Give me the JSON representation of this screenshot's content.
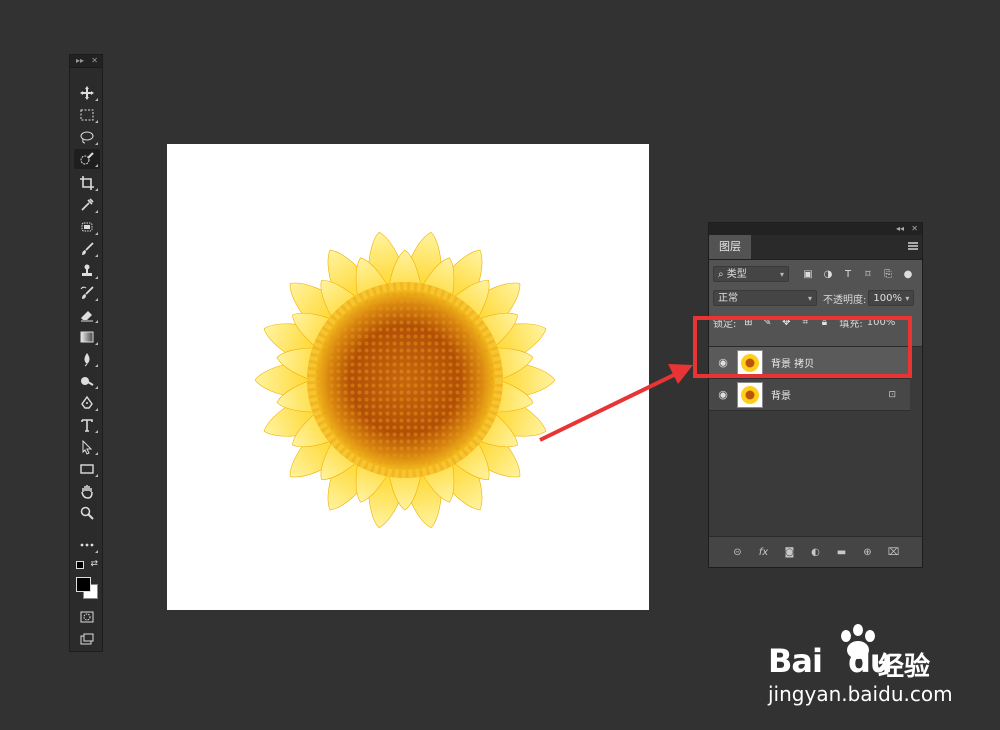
{
  "toolbar": {
    "tools": [
      "move-icon",
      "marquee-icon",
      "lasso-icon",
      "quick-select-icon",
      "crop-icon",
      "eyedropper-icon",
      "healing-icon",
      "brush-icon",
      "stamp-icon",
      "history-brush-icon",
      "eraser-icon",
      "gradient-icon",
      "blur-icon",
      "dodge-icon",
      "pen-icon",
      "text-icon",
      "path-select-icon",
      "rectangle-icon",
      "hand-icon",
      "zoom-icon",
      "more-icon"
    ]
  },
  "layers_panel": {
    "tab_label": "图层",
    "filter": {
      "label": "类型"
    },
    "blend_mode": "正常",
    "opacity_label": "不透明度:",
    "opacity_value": "100%",
    "lock_label": "锁定:",
    "fill_label": "填充:",
    "fill_value": "100%",
    "layers": [
      {
        "name": "背景 拷贝",
        "selected": true
      },
      {
        "name": "背景",
        "selected": false,
        "locked": true
      }
    ]
  },
  "watermark": {
    "brand": "Bai",
    "brand_suffix": "du",
    "brand_cn": "经验",
    "url": "jingyan.baidu.com"
  },
  "colors": {
    "highlight": "#e83434",
    "workspace": "#323232"
  }
}
